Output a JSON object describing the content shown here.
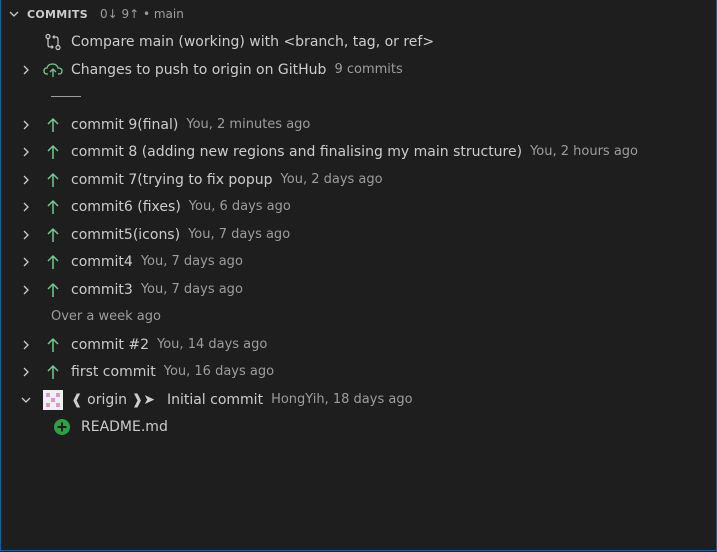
{
  "header": {
    "title": "COMMITS",
    "meta": "0↓ 9↑ • main"
  },
  "compare": {
    "label": "Compare main (working) with <branch, tag, or ref>"
  },
  "push": {
    "label": "Changes to push to origin on GitHub",
    "count": "9 commits"
  },
  "recent_commits": [
    {
      "label": "commit 9(final)",
      "desc": "You, 2 minutes ago"
    },
    {
      "label": "commit 8 (adding new regions and finalising my main structure)",
      "desc": "You, 2 hours ago"
    },
    {
      "label": "commit 7(trying to fix popup",
      "desc": "You, 2 days ago"
    },
    {
      "label": "commit6 (fixes)",
      "desc": "You, 6 days ago"
    },
    {
      "label": "commit5(icons)",
      "desc": "You, 7 days ago"
    },
    {
      "label": "commit4",
      "desc": "You, 7 days ago"
    },
    {
      "label": "commit3",
      "desc": "You, 7 days ago"
    }
  ],
  "group": {
    "label": "Over a week ago"
  },
  "older_commits": [
    {
      "label": "commit #2",
      "desc": "You, 14 days ago"
    },
    {
      "label": "first commit",
      "desc": "You, 16 days ago"
    }
  ],
  "initial": {
    "tag": "❰ origin ❱➤",
    "label": "Initial commit",
    "desc": "HongYih, 18 days ago"
  },
  "file": {
    "label": "README.md"
  },
  "colors": {
    "accent": "#0e639c",
    "arrow": "#73c991",
    "added": "#2ea043",
    "cloud": "#73c991"
  }
}
